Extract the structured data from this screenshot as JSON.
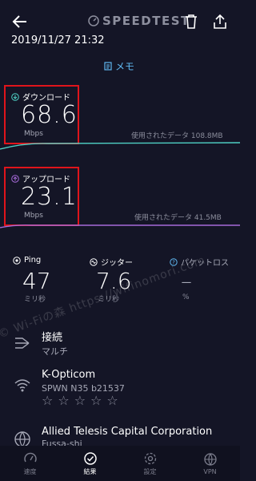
{
  "header": {
    "brand": "SPEEDTEST",
    "datetime": "2019/11/27 21:32",
    "memo_label": "メモ"
  },
  "download": {
    "label": "ダウンロード",
    "value": "68.6",
    "unit": "Mbps",
    "data_used": "使用されたデータ 108.8MB"
  },
  "upload": {
    "label": "アップロード",
    "value": "23.1",
    "unit": "Mbps",
    "data_used": "使用されたデータ 41.5MB"
  },
  "stats": {
    "ping": {
      "label": "Ping",
      "value": "47",
      "unit": "ミリ秒"
    },
    "jitter": {
      "label": "ジッター",
      "value": "7.6",
      "unit": "ミリ秒"
    },
    "packet_loss": {
      "label": "パケットロス",
      "value": "–",
      "unit": "%"
    }
  },
  "connection": {
    "title": "接続",
    "value": "マルチ"
  },
  "isp": {
    "name": "K-Opticom",
    "detail": "SPWN  N35  b21537",
    "stars": "☆☆☆☆☆"
  },
  "server": {
    "name": "Allied Telesis Capital Corporation",
    "location": "Fussa-shi"
  },
  "watermark": "© Wi-Fiの森  https://wifinomori.com",
  "nav": [
    {
      "label": "速度"
    },
    {
      "label": "結果"
    },
    {
      "label": "設定"
    },
    {
      "label": "VPN"
    }
  ],
  "colors": {
    "background": "#141526",
    "accent": "#5fb7f0",
    "download_line": "#4fd1c5",
    "upload_line": "#a66ad8",
    "highlight_box": "#e0141b"
  }
}
